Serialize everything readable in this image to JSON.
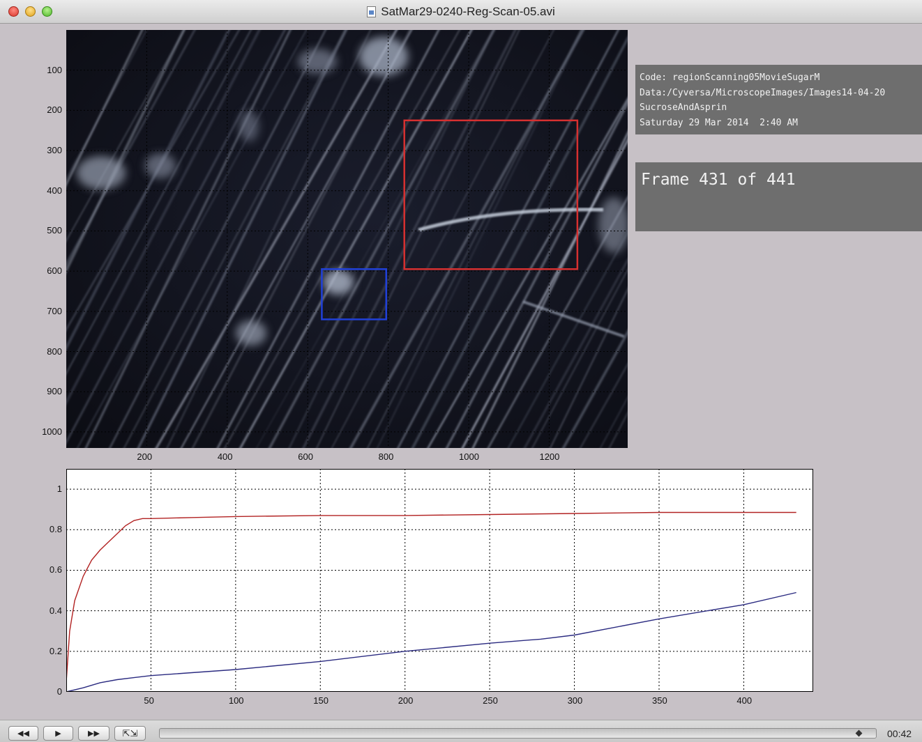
{
  "window": {
    "title": "SatMar29-0240-Reg-Scan-05.avi"
  },
  "image_panel": {
    "x_ticks": [
      "200",
      "400",
      "600",
      "800",
      "1000",
      "1200"
    ],
    "y_ticks": [
      "100",
      "200",
      "300",
      "400",
      "500",
      "600",
      "700",
      "800",
      "900",
      "1000"
    ],
    "roi_red": {
      "x": [
        840,
        1270
      ],
      "y": [
        225,
        595
      ],
      "color": "#d63030"
    },
    "roi_blue": {
      "x": [
        635,
        795
      ],
      "y": [
        595,
        720
      ],
      "color": "#2040d8"
    }
  },
  "info": {
    "code": "Code: regionScanning05MovieSugarM",
    "data": "Data:/Cyversa/MicroscopeImages/Images14-04-20",
    "name": "SucroseAndAsprin",
    "date": "Saturday 29 Mar 2014  2:40 AM"
  },
  "frame": {
    "label": "Frame 431 of 441"
  },
  "chart_data": {
    "type": "line",
    "xlim": [
      0,
      441
    ],
    "ylim": [
      0,
      1.1
    ],
    "x_ticks": [
      50,
      100,
      150,
      200,
      250,
      300,
      350,
      400
    ],
    "y_ticks": [
      0,
      0.2,
      0.4,
      0.6,
      0.8,
      1
    ],
    "y_tick_labels": [
      "0",
      "0.2",
      "0.4",
      "0.6",
      "0.8",
      "1"
    ],
    "grid": true,
    "series": [
      {
        "color": "#b22222",
        "x": [
          0,
          2,
          5,
          10,
          15,
          20,
          25,
          30,
          35,
          40,
          45,
          50,
          75,
          100,
          150,
          200,
          250,
          300,
          350,
          400,
          431
        ],
        "y": [
          0.05,
          0.3,
          0.45,
          0.57,
          0.65,
          0.7,
          0.74,
          0.78,
          0.82,
          0.845,
          0.855,
          0.855,
          0.86,
          0.865,
          0.87,
          0.87,
          0.875,
          0.88,
          0.885,
          0.885,
          0.885
        ]
      },
      {
        "color": "#2a2a80",
        "x": [
          0,
          10,
          20,
          30,
          40,
          50,
          100,
          150,
          200,
          250,
          280,
          300,
          350,
          400,
          431
        ],
        "y": [
          0.0,
          0.02,
          0.045,
          0.06,
          0.07,
          0.08,
          0.11,
          0.15,
          0.2,
          0.24,
          0.26,
          0.28,
          0.36,
          0.43,
          0.49
        ]
      }
    ]
  },
  "controls": {
    "rewind_icon": "rewind-icon",
    "play_icon": "play-icon",
    "forward_icon": "fast-forward-icon",
    "fullscreen_icon": "resize-icon",
    "progress": 0.977,
    "time": "00:42"
  }
}
